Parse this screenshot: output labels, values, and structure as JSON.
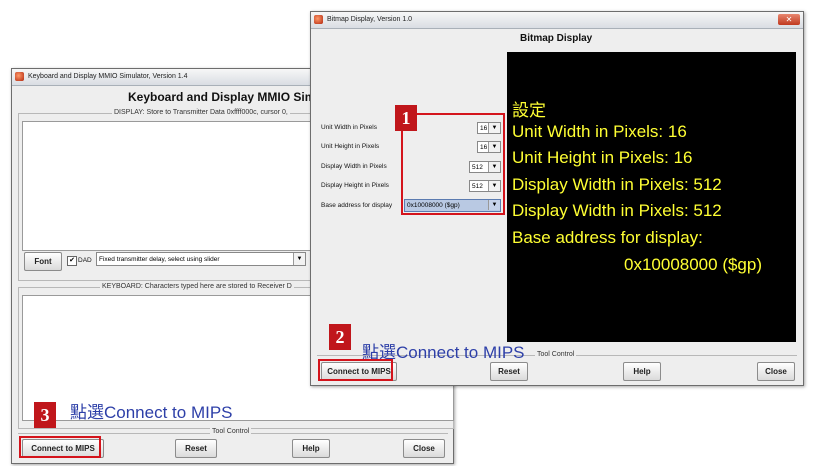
{
  "kbd_window": {
    "title": "Keyboard and Display MMIO Simulator, Version 1.4",
    "heading": "Keyboard and Display MMIO Simu",
    "display_caption": "DISPLAY: Store to Transmitter Data 0xffff000c, cursor 0,",
    "font_button": "Font",
    "dad_label": "DAD",
    "dad_checked": true,
    "delay_select": "Fixed transmitter delay, select using slider",
    "keyboard_caption": "KEYBOARD: Characters typed here are stored to Receiver D",
    "tool_control": "Tool Control",
    "connect_button": "Connect to MIPS",
    "reset_button": "Reset",
    "help_button": "Help",
    "close_button": "Close"
  },
  "bitmap_window": {
    "title": "Bitmap Display, Version 1.0",
    "heading": "Bitmap Display",
    "settings": [
      {
        "label": "Unit Width in Pixels",
        "value": "16"
      },
      {
        "label": "Unit Height in Pixels",
        "value": "16"
      },
      {
        "label": "Display Width in Pixels",
        "value": "512"
      },
      {
        "label": "Display Height in Pixels",
        "value": "512"
      },
      {
        "label": "Base address for display",
        "value": "0x10008000 ($gp)"
      }
    ],
    "tool_control": "Tool Control",
    "connect_button": "Connect to MIPS",
    "reset_button": "Reset",
    "help_button": "Help",
    "close_button": "Close"
  },
  "annotations": {
    "marker_1": "1",
    "marker_2": "2",
    "marker_3": "3",
    "step2_text": "點選Connect to MIPS",
    "step3_text": "點選Connect to MIPS",
    "info_lines": [
      "設定",
      "Unit Width in Pixels: 16",
      "Unit Height in Pixels: 16",
      "Display Width in Pixels: 512",
      "Display Width in Pixels: 512",
      "Base address for display:",
      "0x10008000 ($gp)"
    ]
  },
  "colors": {
    "highlight_red": "#d4141c",
    "marker_red": "#c0161b",
    "annotation_blue": "#2d3fa8",
    "info_yellow": "#ffff33",
    "display_black": "#000000"
  }
}
